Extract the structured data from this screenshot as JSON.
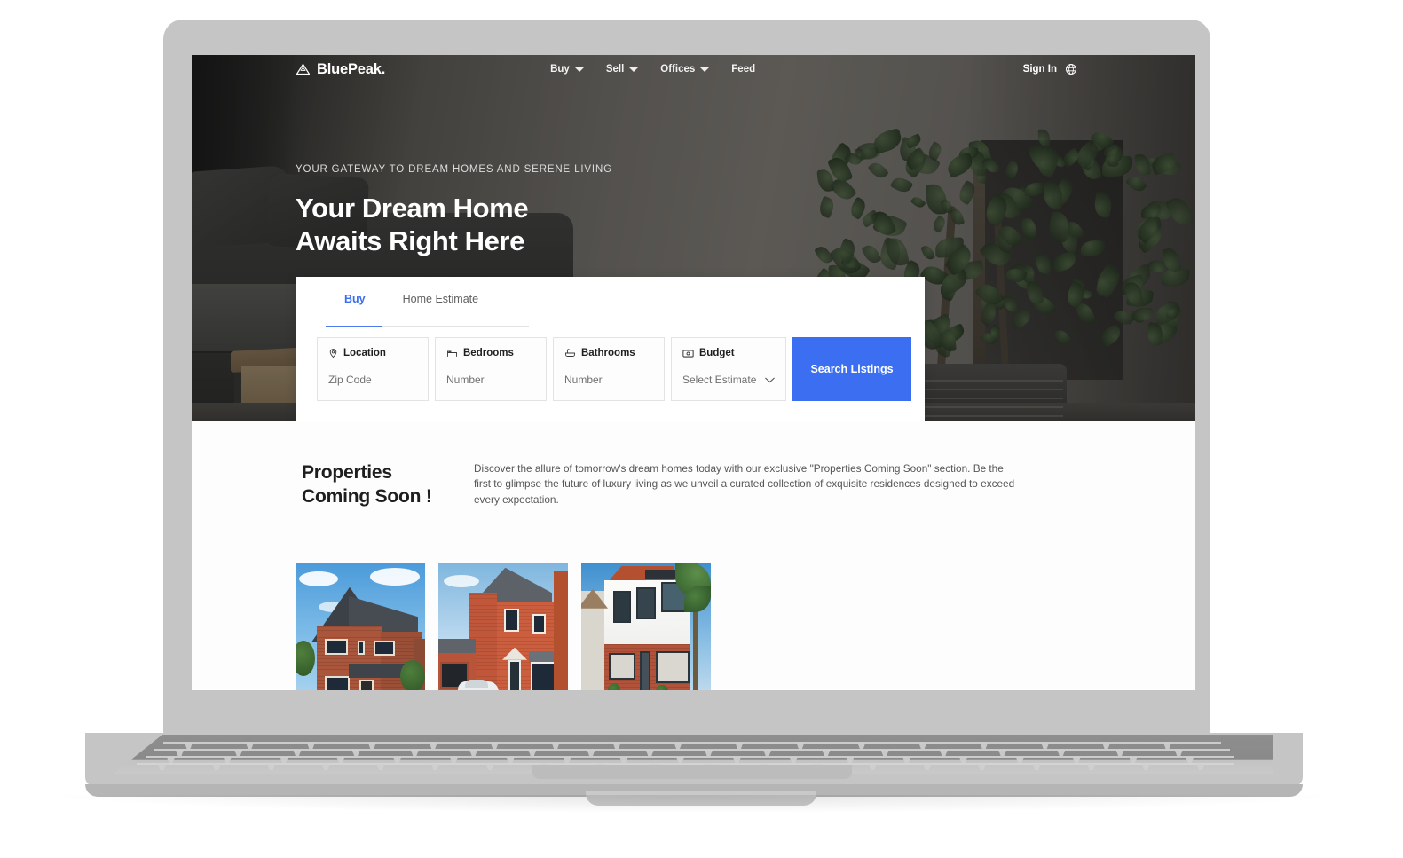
{
  "site": {
    "brand_name": "BluePeak.",
    "logo_icon": "mountain-peak-icon",
    "accent_color": "#3b6ef0",
    "nav": [
      {
        "label": "Buy",
        "has_dropdown": true
      },
      {
        "label": "Sell",
        "has_dropdown": true
      },
      {
        "label": "Offices",
        "has_dropdown": true
      },
      {
        "label": "Feed",
        "has_dropdown": false
      }
    ],
    "sign_in_label": "Sign In",
    "language_icon": "globe-icon"
  },
  "hero": {
    "eyebrow": "YOUR GATEWAY TO DREAM HOMES AND SERENE LIVING",
    "heading_line1": "Your Dream Home",
    "heading_line2": "Awaits Right Here",
    "background": "dimmed interior photo with gray sofa, wooden side table and tall potted ficus plant"
  },
  "search_card": {
    "tabs": [
      {
        "label": "Buy",
        "active": true
      },
      {
        "label": "Home Estimate",
        "active": false
      }
    ],
    "fields": [
      {
        "icon": "map-pin-icon",
        "label": "Location",
        "placeholder": "Zip Code",
        "type": "text"
      },
      {
        "icon": "bed-icon",
        "label": "Bedrooms",
        "placeholder": "Number",
        "type": "text"
      },
      {
        "icon": "bathtub-icon",
        "label": "Bathrooms",
        "placeholder": "Number",
        "type": "text"
      },
      {
        "icon": "banknote-icon",
        "label": "Budget",
        "placeholder": "Select Estimate",
        "type": "select"
      }
    ],
    "submit_label": "Search Listings"
  },
  "properties_section": {
    "heading_line1": "Properties",
    "heading_line2": "Coming Soon !",
    "description": "Discover the allure of tomorrow's dream homes today with our exclusive \"Properties Coming Soon\" section. Be the first to glimpse the future of luxury living as we unveil a curated collection of exquisite residences designed to exceed every expectation.",
    "cards": [
      {
        "alt": "Red brick detached house with dark slate roof under blue sky"
      },
      {
        "alt": "Orange brick new-build house with garage and white car"
      },
      {
        "alt": "White rendered house with red brick base, dark windows and palm tree"
      }
    ]
  },
  "device": {
    "type": "laptop",
    "frame_color": "#c5c5c5"
  }
}
